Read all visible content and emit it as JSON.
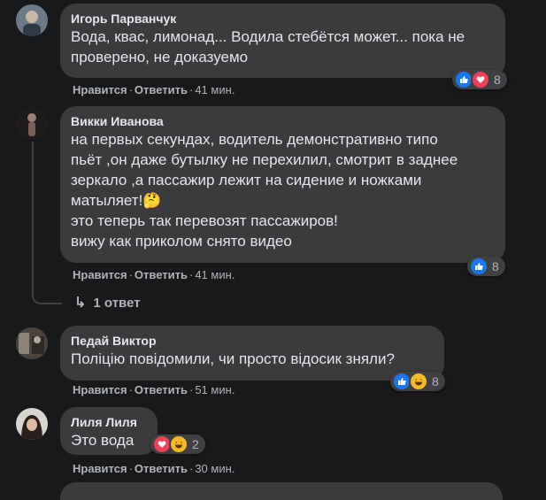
{
  "comments": [
    {
      "author": "Игорь Парванчук",
      "text": "Вода, квас, лимонад... Водила стебётся может... пока не\nпроверено, не доказуемо",
      "like_label": "Нравится",
      "reply_label": "Ответить",
      "time": "41 мин.",
      "reactions": [
        "like",
        "love"
      ],
      "reaction_count": "8"
    },
    {
      "author": "Викки Иванова",
      "text": "на первых секундах, водитель демонстративно типо\nпьёт ,он даже бутылку не перехилил, смотрит в заднее\nзеркало ,а пассажир лежит на сидение и ножками\nматыляет!🤔\nэто теперь так перевозят пассажиров!\nвижу как приколом снято видео",
      "like_label": "Нравится",
      "reply_label": "Ответить",
      "time": "41 мин.",
      "reactions": [
        "like"
      ],
      "reaction_count": "8",
      "replies_label": "1 ответ"
    },
    {
      "author": "Педай Виктор",
      "text": "Поліцію повідомили, чи просто відосик зняли?",
      "like_label": "Нравится",
      "reply_label": "Ответить",
      "time": "51 мин.",
      "reactions": [
        "like",
        "haha"
      ],
      "reaction_count": "8"
    },
    {
      "author": "Лиля Лиля",
      "text": "Это вода",
      "like_label": "Нравится",
      "reply_label": "Ответить",
      "time": "30 мин.",
      "reactions": [
        "love",
        "haha"
      ],
      "reaction_count": "2"
    }
  ],
  "colors": {
    "background": "#18191a",
    "bubble": "#3a3b3c",
    "text": "#e4e6eb",
    "secondary": "#b0b3b8",
    "like_blue": "#1877f2",
    "love_red": "#f33e58",
    "haha_yellow": "#f7b928"
  },
  "icons": {
    "like": "thumbs-up-icon",
    "love": "heart-icon",
    "haha": "laughing-face-icon",
    "reply_arrow": "reply-arrow-icon"
  }
}
